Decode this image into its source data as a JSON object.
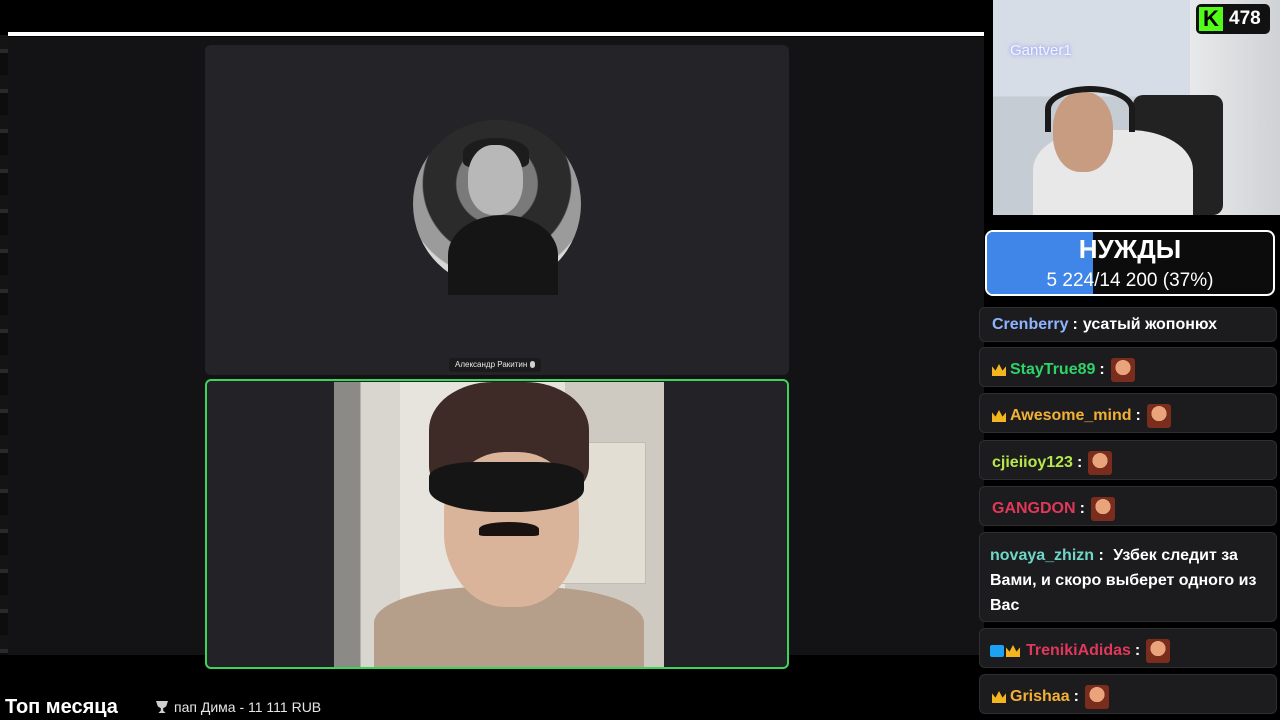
{
  "call": {
    "participant_top_name": "Александр Ракитин"
  },
  "stream": {
    "streamer_name": "Gantver1",
    "viewer_count": "478",
    "platform_logo_letter": "K",
    "accent_color": "#53fc18"
  },
  "goal": {
    "title": "НУЖДЫ",
    "progress_text": "5 224/14 200 (37%)",
    "percent": 37,
    "fill_color": "#3f86e8"
  },
  "chat": {
    "messages": [
      {
        "user": "Crenberry",
        "sep": " :",
        "text": "усатый жопонюх",
        "color": "#8fb4ff"
      },
      {
        "user": "StayTrue89",
        "sep": " :",
        "color": "#2fd36a"
      },
      {
        "user": "Awesome_mind",
        "sep": " :",
        "color": "#f2b134"
      },
      {
        "user": "cjieiioy123",
        "sep": " :",
        "color": "#b6e84a"
      },
      {
        "user": "GANGDON",
        "sep": " :",
        "color": "#e0385a"
      },
      {
        "user": "novaya_zhizn",
        "sep": " :",
        "text": "Узбек следит за Вами, и скоро выберет одного из Вас",
        "color": "#6fd6c8"
      },
      {
        "user": "TrenikiAdidas",
        "sep": " :",
        "color": "#e0385a"
      },
      {
        "user": "Grishaa",
        "sep": " :",
        "color": "#f2b134"
      }
    ]
  },
  "bottom": {
    "title": "Топ месяца",
    "top_entry": "пап Дима - 11 111 RUB"
  }
}
